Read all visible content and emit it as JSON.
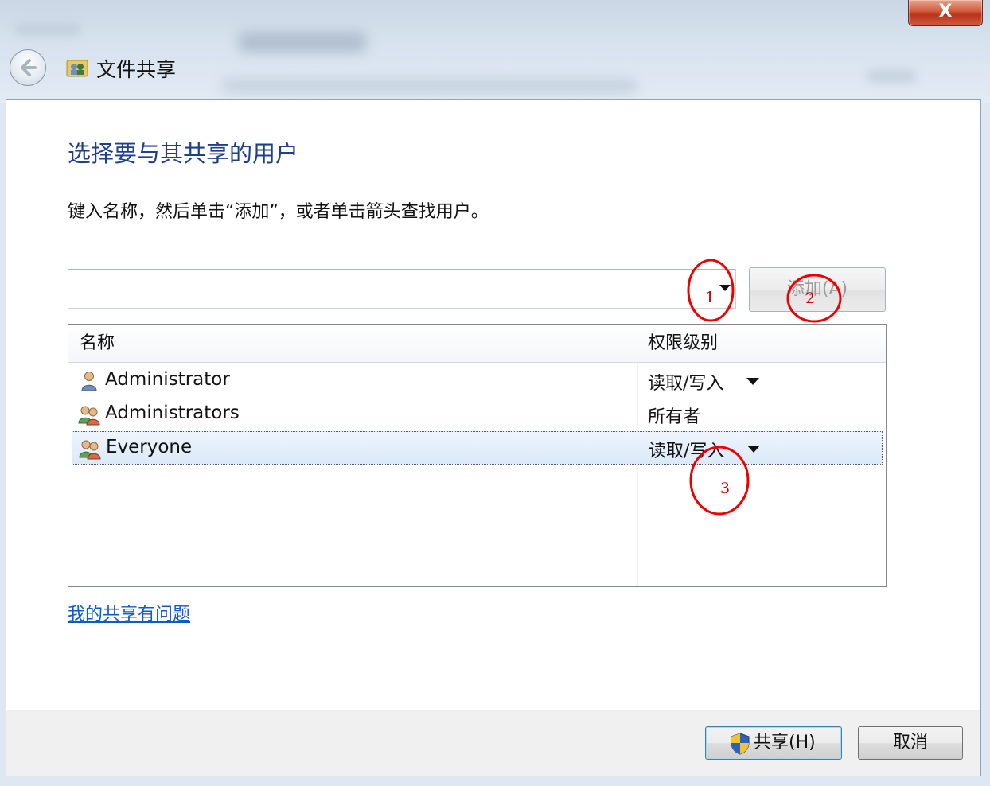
{
  "window": {
    "title": "文件共享",
    "close_label": "X"
  },
  "dialog": {
    "heading": "选择要与其共享的用户",
    "instruction": "键入名称，然后单击“添加”，或者单击箭头查找用户。",
    "name_input": {
      "value": "",
      "placeholder": ""
    },
    "add_button": "添加(A)",
    "table": {
      "headers": {
        "name": "名称",
        "permission": "权限级别"
      },
      "rows": [
        {
          "name": "Administrator",
          "permission": "读取/写入",
          "icon": "user-icon",
          "has_dropdown": true
        },
        {
          "name": "Administrators",
          "permission": "所有者",
          "icon": "group-icon",
          "has_dropdown": false
        },
        {
          "name": "Everyone",
          "permission": "读取/写入",
          "icon": "group-icon",
          "has_dropdown": true,
          "selected": true
        }
      ]
    },
    "help_link": "我的共享有问题"
  },
  "footer": {
    "share_button": "共享(H)",
    "cancel_button": "取消"
  },
  "annotations": [
    {
      "label": "1",
      "color": "#e00000"
    },
    {
      "label": "2",
      "color": "#e00000"
    },
    {
      "label": "3",
      "color": "#e00000"
    }
  ]
}
